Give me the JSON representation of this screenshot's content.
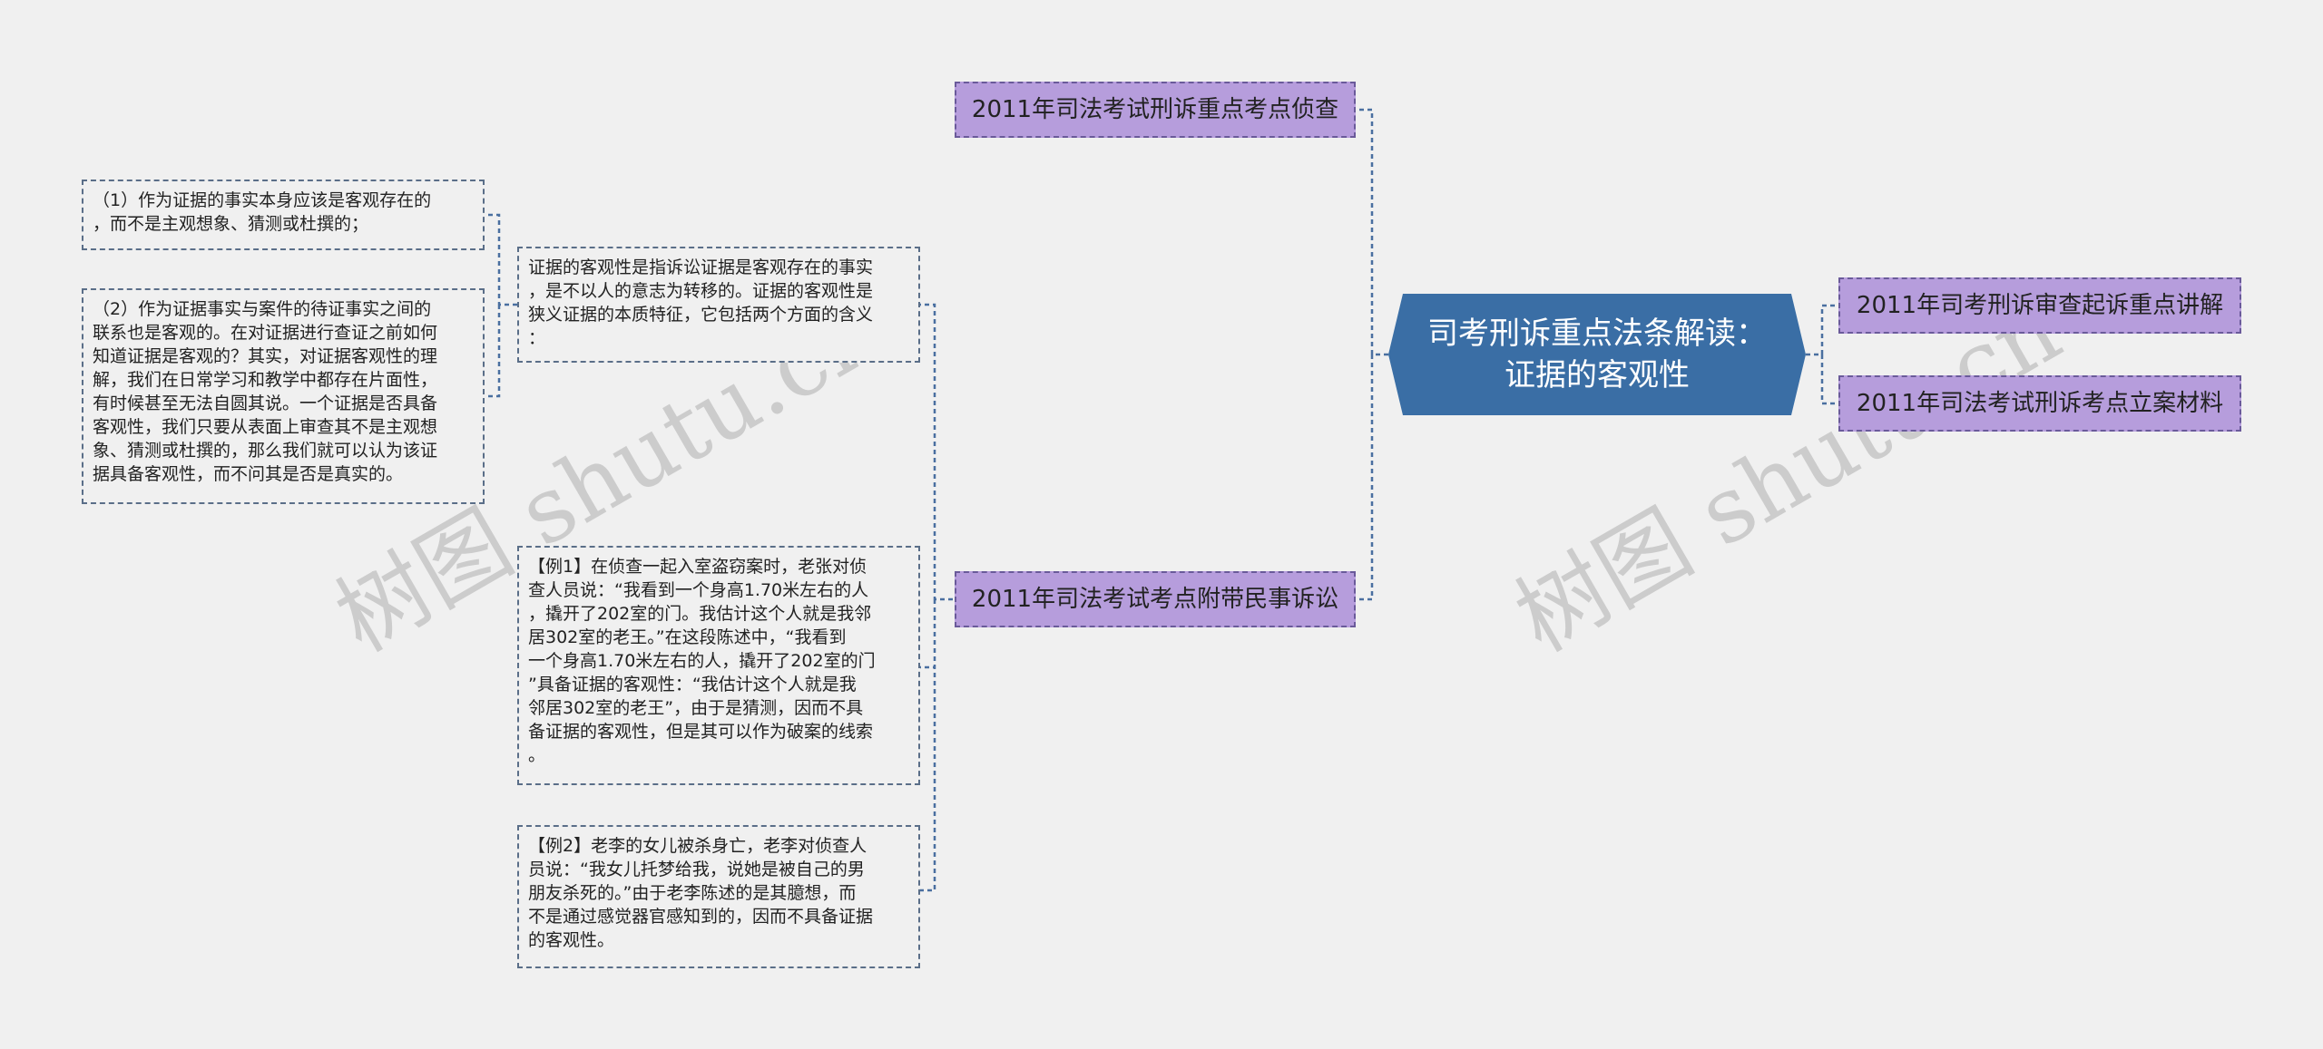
{
  "central": {
    "title_line1": "司考刑诉重点法条解读：",
    "title_line2": "证据的客观性"
  },
  "branches": {
    "top_left": "2011年司法考试刑诉重点考点侦查",
    "bottom_left": "2011年司法考试考点附带民事诉讼",
    "right_1": "2011年司考刑诉审查起诉重点讲解",
    "right_2": "2011年司法考试刑诉考点立案材料"
  },
  "notes": {
    "definition": "证据的客观性是指诉讼证据是客观存在的事实\n，是不以人的意志为转移的。证据的客观性是\n狭义证据的本质特征，它包括两个方面的含义\n：",
    "point1": "（1）作为证据的事实本身应该是客观存在的\n，而不是主观想象、猜测或杜撰的；",
    "point2": "（2）作为证据事实与案件的待证事实之间的\n联系也是客观的。在对证据进行查证之前如何\n知道证据是客观的？其实，对证据客观性的理\n解，我们在日常学习和教学中都存在片面性，\n有时候甚至无法自圆其说。一个证据是否具备\n客观性，我们只要从表面上审查其不是主观想\n象、猜测或杜撰的，那么我们就可以认为该证\n据具备客观性，而不问其是否是真实的。",
    "example1": "【例1】在侦查一起入室盗窃案时，老张对侦\n查人员说：“我看到一个身高1.70米左右的人\n，撬开了202室的门。我估计这个人就是我邻\n居302室的老王。”在这段陈述中，“我看到\n一个身高1.70米左右的人，撬开了202室的门\n”具备证据的客观性：“我估计这个人就是我\n邻居302室的老王”，由于是猜测，因而不具\n备证据的客观性，但是其可以作为破案的线索\n。",
    "example2": "【例2】老李的女儿被杀身亡，老李对侦查人\n员说：“我女儿托梦给我，说她是被自己的男\n朋友杀死的。”由于老李陈述的是其臆想，而\n不是通过感觉器官感知到的，因而不具备证据\n的客观性。"
  },
  "watermarks": [
    "树图 shutu.cn",
    "树图 shutu.cn"
  ],
  "colors": {
    "background": "#f0f0f0",
    "central_fill": "#3a6ea5",
    "branch_fill": "#b69ddc",
    "connector": "#3a6ea5"
  }
}
